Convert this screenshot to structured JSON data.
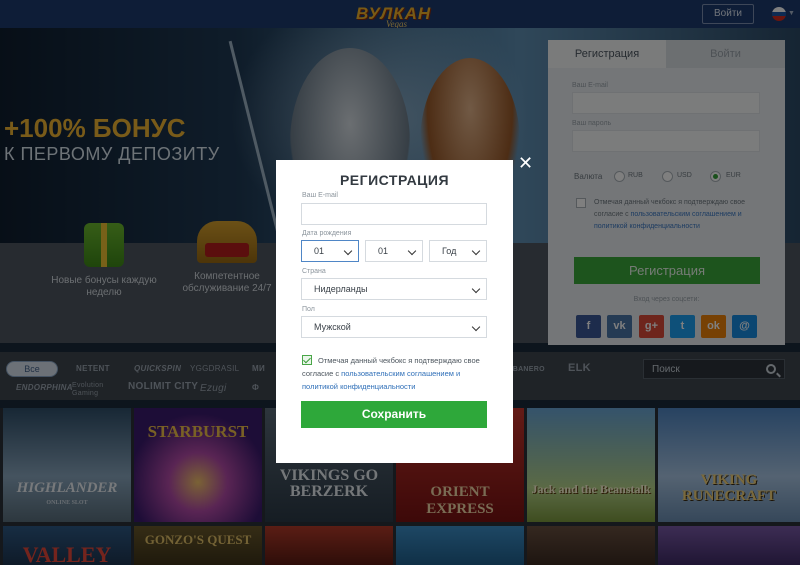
{
  "header": {
    "logo_main": "ВУЛКАН",
    "logo_sub": "Vegas",
    "login_label": "Войти",
    "language_flag": "russian-flag-icon",
    "colors": {
      "bar": "#1d3b6e",
      "logo": "#f3b52a"
    }
  },
  "hero": {
    "bonus_line1": "+100% БОНУС",
    "bonus_line2": "К ПЕРВОМУ ДЕПОЗИТУ"
  },
  "features": [
    {
      "icon": "gift-icon",
      "label": "Новые бонусы каждую неделю"
    },
    {
      "icon": "crown-icon",
      "label": "Компетентное обслуживание 24/7"
    }
  ],
  "filters": {
    "all_label": "Все",
    "providers_row1": [
      "NETENT",
      "QUICKSPIN",
      "YGGDRASIL",
      "МИ",
      "HABANERO",
      "ELK"
    ],
    "providers_row2": [
      "ENDORPHINA",
      "Evolution Gaming",
      "NOLIMIT CITY",
      "Ezugi",
      "Ф"
    ],
    "search_placeholder": "Поиск"
  },
  "games": [
    {
      "title": "HIGHLANDER",
      "subtitle": "ONLINE SLOT"
    },
    {
      "title": "STARBURST",
      "subtitle": ""
    },
    {
      "title": "VIKINGS GO BERZERK",
      "subtitle": ""
    },
    {
      "title": "ORIENT EXPRESS",
      "subtitle": ""
    },
    {
      "title": "Jack and the Beanstalk",
      "subtitle": ""
    },
    {
      "title": "VIKING RUNECRAFT",
      "subtitle": ""
    },
    {
      "title": "VALLEY",
      "subtitle": ""
    },
    {
      "title": "GONZO'S QUEST",
      "subtitle": ""
    }
  ],
  "side_registration": {
    "tab_register": "Регистрация",
    "tab_login": "Войти",
    "email_label": "Ваш E-mail",
    "password_label": "Ваш пароль",
    "currency_label": "Валюта",
    "currencies": [
      "RUB",
      "USD",
      "EUR"
    ],
    "selected_currency": "EUR",
    "consent_prefix": "Отмечая данный чекбокс я подтверждаю свое согласие с ",
    "consent_link": "пользовательским соглашением и политикой конфиденциальности",
    "submit_label": "Регистрация",
    "social_label": "Вход через соцсети:",
    "social": [
      {
        "icon": "facebook-icon",
        "glyph": "f",
        "color": "#3b5998"
      },
      {
        "icon": "vk-icon",
        "glyph": "vk",
        "color": "#4a76a8"
      },
      {
        "icon": "google-plus-icon",
        "glyph": "g+",
        "color": "#dd4b39"
      },
      {
        "icon": "twitter-icon",
        "glyph": "t",
        "color": "#1da1f2"
      },
      {
        "icon": "odnoklassniki-icon",
        "glyph": "ok",
        "color": "#ee8208"
      },
      {
        "icon": "mail-icon",
        "glyph": "@",
        "color": "#168de2"
      }
    ]
  },
  "modal": {
    "title": "РЕГИСТРАЦИЯ",
    "email_label": "Ваш E-mail",
    "email_value": "",
    "dob_label": "Дата рождения",
    "dob_day": "01",
    "dob_month": "01",
    "dob_year": "Год",
    "country_label": "Страна",
    "country_value": "Нидерланды",
    "gender_label": "Пол",
    "gender_value": "Мужской",
    "consent_checked": true,
    "consent_prefix": "Отмечая данный чекбокс я подтверждаю свое согласие с ",
    "consent_link": "пользовательским соглашением и политикой конфиденциальности",
    "submit_label": "Сохранить",
    "close_glyph": "✕",
    "colors": {
      "accent": "#2ea83a",
      "link": "#2f6fb8"
    }
  }
}
